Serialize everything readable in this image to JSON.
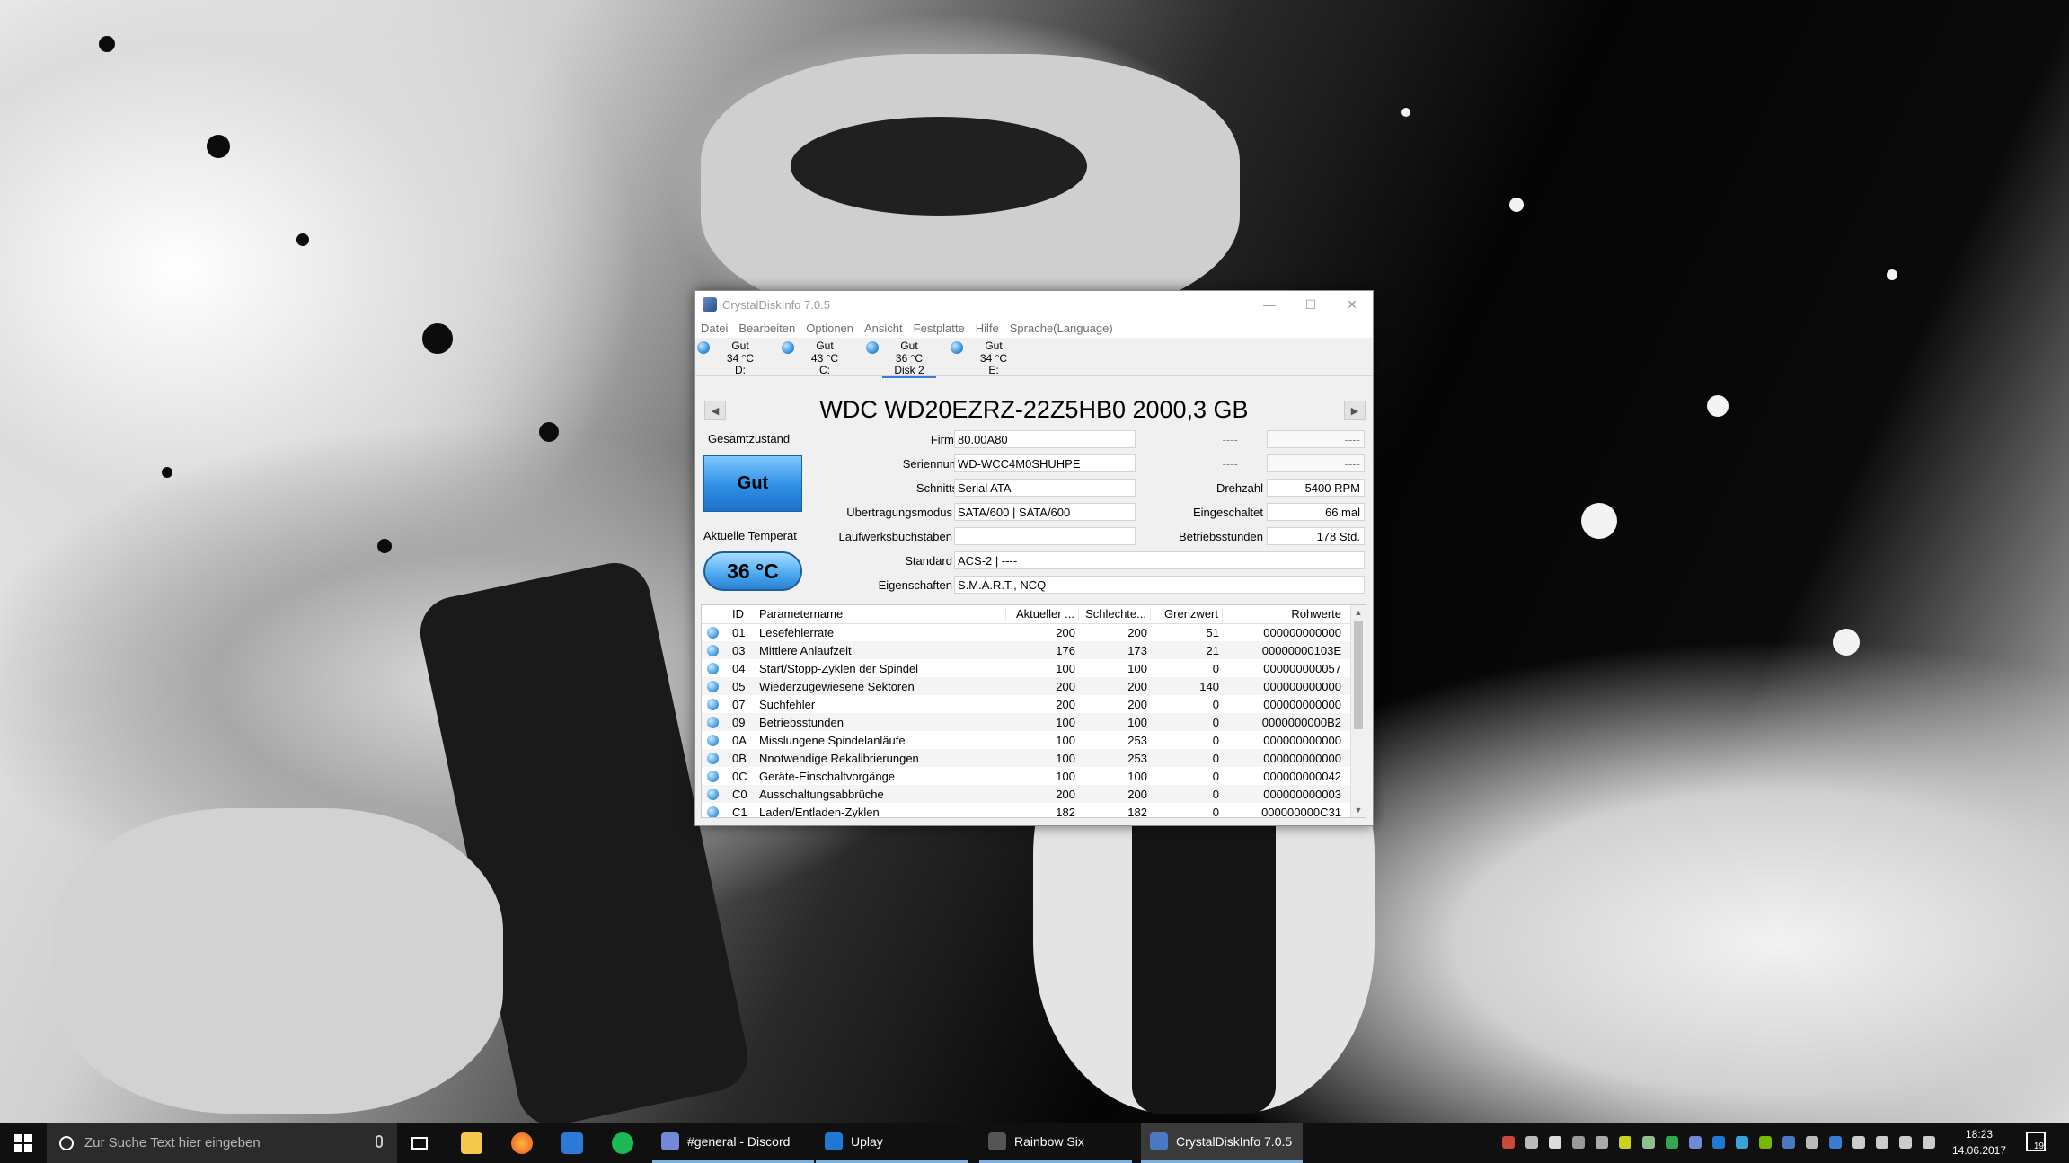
{
  "window": {
    "title": "CrystalDiskInfo 7.0.5",
    "controls": {
      "minimize": "—",
      "maximize": "☐",
      "close": "✕"
    }
  },
  "menu": [
    "Datei",
    "Bearbeiten",
    "Optionen",
    "Ansicht",
    "Festplatte",
    "Hilfe",
    "Sprache(Language)"
  ],
  "disks": [
    {
      "status": "Gut",
      "temp": "34 °C",
      "label": "D:"
    },
    {
      "status": "Gut",
      "temp": "43 °C",
      "label": "C:"
    },
    {
      "status": "Gut",
      "temp": "36 °C",
      "label": "Disk 2"
    },
    {
      "status": "Gut",
      "temp": "34 °C",
      "label": "E:"
    }
  ],
  "active_disk_index": 2,
  "disk": {
    "model": "WDC WD20EZRZ-22Z5HB0 2000,3 GB",
    "health_label": "Gesamtzustand",
    "health": "Gut",
    "temp_label": "Aktuelle Temperat",
    "temp": "36 °C",
    "labels": {
      "firmware": "Firmware",
      "serial": "Seriennummer",
      "interface": "Schnittstelle",
      "transfer": "Übertragungsmodus",
      "drive_letters": "Laufwerksbuchstaben",
      "standard": "Standard",
      "features": "Eigenschaften",
      "rotation": "Drehzahl",
      "power_on_count": "Eingeschaltet",
      "power_on_hours": "Betriebsstunden",
      "blank1": "----",
      "blank2": "----"
    },
    "values": {
      "firmware": "80.00A80",
      "serial": "WD-WCC4M0SHUHPE",
      "interface": "Serial ATA",
      "transfer": "SATA/600 | SATA/600",
      "drive_letters": "",
      "standard": "ACS-2 | ----",
      "features": "S.M.A.R.T., NCQ",
      "rotation": "5400 RPM",
      "power_on_count": "66 mal",
      "power_on_hours": "178 Std.",
      "blank1": "----",
      "blank2": "----"
    }
  },
  "smart": {
    "headers": [
      "ID",
      "Parametername",
      "Aktueller ...",
      "Schlechte...",
      "Grenzwert",
      "Rohwerte"
    ],
    "rows": [
      [
        "01",
        "Lesefehlerrate",
        "200",
        "200",
        "51",
        "000000000000"
      ],
      [
        "03",
        "Mittlere Anlaufzeit",
        "176",
        "173",
        "21",
        "00000000103E"
      ],
      [
        "04",
        "Start/Stopp-Zyklen der Spindel",
        "100",
        "100",
        "0",
        "000000000057"
      ],
      [
        "05",
        "Wiederzugewiesene Sektoren",
        "200",
        "200",
        "140",
        "000000000000"
      ],
      [
        "07",
        "Suchfehler",
        "200",
        "200",
        "0",
        "000000000000"
      ],
      [
        "09",
        "Betriebsstunden",
        "100",
        "100",
        "0",
        "0000000000B2"
      ],
      [
        "0A",
        "Misslungene Spindelanläufe",
        "100",
        "253",
        "0",
        "000000000000"
      ],
      [
        "0B",
        "Nnotwendige Rekalibrierungen",
        "100",
        "253",
        "0",
        "000000000000"
      ],
      [
        "0C",
        "Geräte-Einschaltvorgänge",
        "100",
        "100",
        "0",
        "000000000042"
      ],
      [
        "C0",
        "Ausschaltungsabbrüche",
        "200",
        "200",
        "0",
        "000000000003"
      ],
      [
        "C1",
        "Laden/Entladen-Zyklen",
        "182",
        "182",
        "0",
        "000000000C31"
      ]
    ]
  },
  "taskbar": {
    "search_placeholder": "Zur Suche Text hier eingeben",
    "apps": [
      {
        "label": "#general - Discord",
        "color": "#7289da"
      },
      {
        "label": "Uplay",
        "color": "#1f78d1"
      },
      {
        "label": "Rainbow Six",
        "color": "#555555"
      },
      {
        "label": "CrystalDiskInfo 7.0.5",
        "color": "#4a78c2"
      }
    ],
    "time": "18:23",
    "date": "14.06.2017",
    "notification_count": "19"
  }
}
